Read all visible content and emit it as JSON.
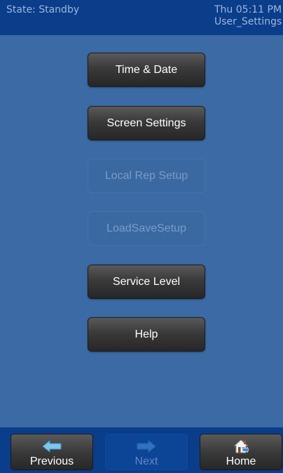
{
  "status_bar": {
    "state": "State: Standby",
    "datetime": "Thu 05:11 PM",
    "screen_name": "User_Settings"
  },
  "menu": {
    "items": [
      {
        "label": "Time & Date",
        "enabled": true
      },
      {
        "label": "Screen Settings",
        "enabled": true
      },
      {
        "label": "Local Rep Setup",
        "enabled": false
      },
      {
        "label": "LoadSaveSetup",
        "enabled": false
      },
      {
        "label": "Service Level",
        "enabled": true
      },
      {
        "label": "Help",
        "enabled": true
      }
    ]
  },
  "bottom_nav": {
    "previous": {
      "label": "Previous",
      "icon": "left-arrow-icon",
      "enabled": true
    },
    "next": {
      "label": "Next",
      "icon": "right-arrow-icon",
      "enabled": false
    },
    "home": {
      "label": "Home",
      "icon": "home-icon",
      "enabled": true
    }
  },
  "colors": {
    "background": "#3b6aa5",
    "bar": "#0a3d8a",
    "button_dark": "#333333",
    "button_disabled_text": "#7a9cc6",
    "arrow_enabled": "#7fc6ec",
    "arrow_disabled": "#2e72c2"
  }
}
